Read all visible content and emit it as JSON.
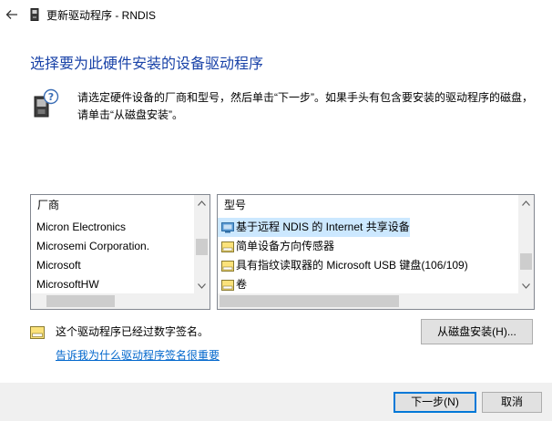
{
  "window": {
    "title": "更新驱动程序 - RNDIS"
  },
  "heading": "选择要为此硬件安装的设备驱动程序",
  "description": {
    "line1": "请选定硬件设备的厂商和型号，然后单击“下一步”。如果手头有包含要安装的驱动程序的磁盘，",
    "line2": "请单击“从磁盘安装”。"
  },
  "manufacturer_list": {
    "header": "厂商",
    "items": [
      "Micron Electronics",
      "Microsemi Corporation.",
      "Microsoft",
      "MicrosoftHW"
    ],
    "selected": "Microsoft"
  },
  "model_list": {
    "header": "型号",
    "items": [
      "基于远程 NDIS 的 Internet 共享设备",
      "简单设备方向传感器",
      "具有指纹读取器的 Microsoft USB 键盘(106/109)",
      "卷"
    ],
    "selected_index": 0
  },
  "signature": {
    "status": "这个驱动程序已经过数字签名。",
    "link": "告诉我为什么驱动程序签名很重要"
  },
  "buttons": {
    "have_disk": "从磁盘安装(H)...",
    "next": "下一步(N)",
    "cancel": "取消"
  },
  "colors": {
    "heading": "#1a43a8",
    "link": "#0066cc",
    "selection": "#cce8ff",
    "accent_border": "#0078d7"
  },
  "icons": [
    "back-arrow-icon",
    "device-icon",
    "hardware-help-icon",
    "network-adapter-icon",
    "signed-driver-icon"
  ]
}
